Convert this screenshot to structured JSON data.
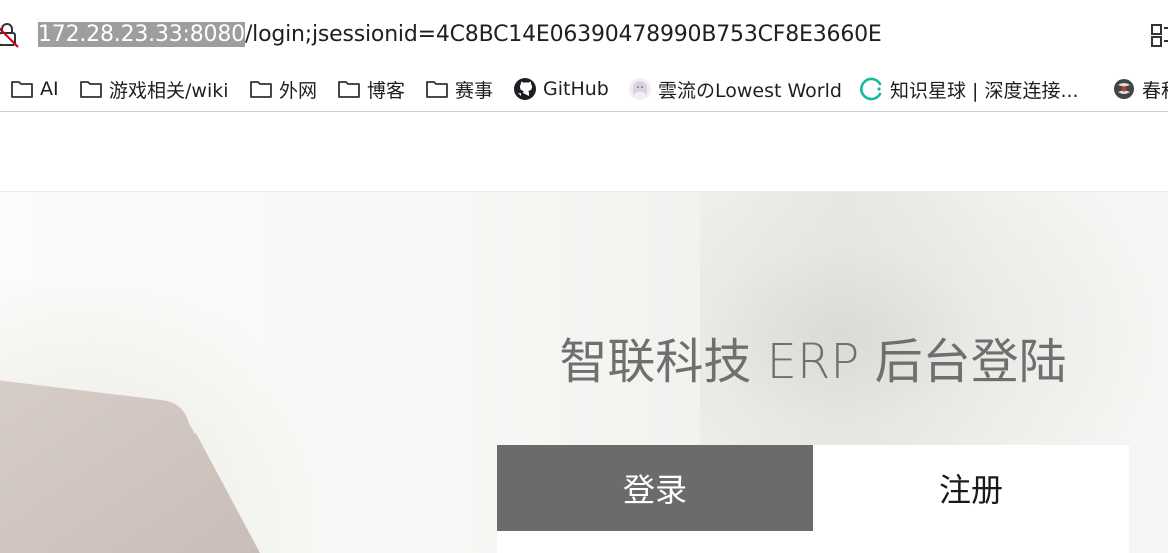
{
  "address_bar": {
    "url_host": "172.28.23.33:8080",
    "url_path": "/login;jsessionid=4C8BC14E06390478990B753CF8E3660E"
  },
  "bookmarks": [
    {
      "label": "AI",
      "icon": "folder-icon"
    },
    {
      "label": "游戏相关/wiki",
      "icon": "folder-icon"
    },
    {
      "label": "外网",
      "icon": "folder-icon"
    },
    {
      "label": "博客",
      "icon": "folder-icon"
    },
    {
      "label": "赛事",
      "icon": "folder-icon"
    },
    {
      "label": "GitHub",
      "icon": "github-icon"
    },
    {
      "label": "雲流のLowest World",
      "icon": "avatar-icon"
    },
    {
      "label": "知识星球 | 深度连接...",
      "icon": "zsxq-icon"
    },
    {
      "label": "春秋",
      "icon": "site-icon"
    }
  ],
  "login": {
    "title": "智联科技 ERP 后台登陆",
    "tabs": [
      {
        "label": "登录",
        "active": true
      },
      {
        "label": "注册",
        "active": false
      }
    ]
  },
  "colors": {
    "active_tab": "#6b6b6b",
    "title_text": "#6f6f6f",
    "url_highlight": "#9e9e9e"
  }
}
